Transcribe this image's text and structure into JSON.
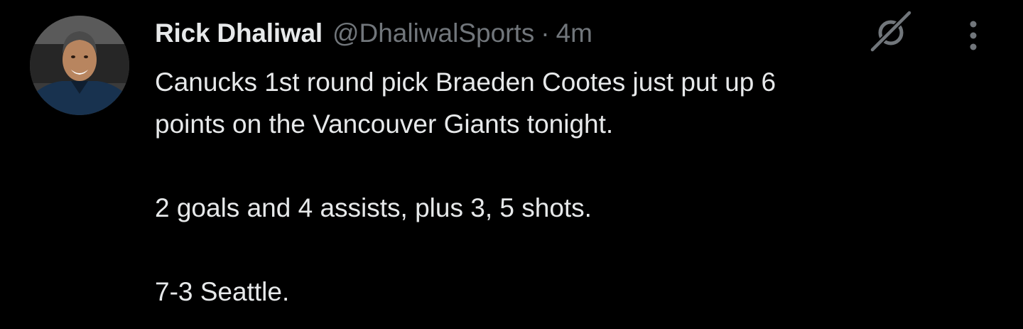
{
  "author": {
    "display_name": "Rick Dhaliwal",
    "handle": "@DhaliwalSports",
    "separator": "·",
    "timestamp": "4m",
    "avatar_icon": "profile-photo"
  },
  "icons": {
    "grok": "grok-icon",
    "more": "more-vertical-icon"
  },
  "tweet": {
    "line1": "Canucks 1st round pick Braeden Cootes just put up 6",
    "line2": "points on the Vancouver Giants tonight.",
    "line3": "2 goals and 4 assists, plus 3, 5 shots.",
    "line4": "7-3 Seattle."
  },
  "colors": {
    "background": "#000000",
    "primary_text": "#e7e9ea",
    "secondary_text": "#71767b"
  }
}
